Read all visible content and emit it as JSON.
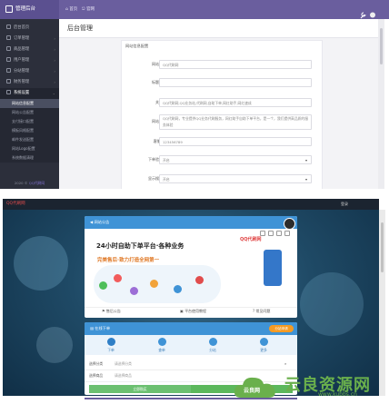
{
  "admin": {
    "brand": "管理后台",
    "top_links": [
      "首页",
      "官网"
    ],
    "page_title": "后台管理",
    "sidebar": {
      "items": [
        {
          "label": "后台首页"
        },
        {
          "label": "订单管理"
        },
        {
          "label": "商品管理"
        },
        {
          "label": "用户管理"
        },
        {
          "label": "分站管理"
        },
        {
          "label": "财务管理"
        },
        {
          "label": "系统设置",
          "active": true
        }
      ],
      "subitems": [
        {
          "label": "网站信息配置",
          "selected": true
        },
        {
          "label": "网站公告配置"
        },
        {
          "label": "支付接口配置"
        },
        {
          "label": "模板风格配置"
        },
        {
          "label": "邮件发送配置"
        },
        {
          "label": "网站Logo配置"
        },
        {
          "label": "系统数据清理"
        }
      ],
      "footer_prefix": "2020 ©",
      "footer_link": "QQ代刷网"
    },
    "form": {
      "title": "网站信息配置",
      "rows": [
        {
          "label": "网站名称",
          "value": "QQ代刷网",
          "type": "input"
        },
        {
          "label": "标题后缀",
          "value": "",
          "type": "input"
        },
        {
          "label": "关键字",
          "value": "QQ代刷网,QQ业务站,代刷网,自助下单,网红助手,网红速成",
          "type": "input"
        },
        {
          "label": "网站描述",
          "value": "QQ代刷网，专业提供QQ业务代刷服务，网红助手自助下单平台，是一个，我们提供高品质的服务体验",
          "type": "textarea"
        },
        {
          "label": "客服QQ",
          "value": "123456789",
          "type": "input"
        },
        {
          "label": "下单验证码",
          "value": "开启",
          "type": "select"
        },
        {
          "label": "显示搜索框",
          "value": "开启",
          "type": "select"
        }
      ]
    }
  },
  "site": {
    "brand": "QQ代刷网",
    "login": "登录",
    "panel1": {
      "title": "网站公告",
      "headline": "24小时自助下单平台·各种业务",
      "subline": "完美售后·致力打造全网第一",
      "logo_text": "QQ代刷网",
      "footer": [
        "售后公告",
        "平台使用教程",
        "常见问题"
      ]
    },
    "panel2": {
      "title": "在线下单",
      "badge": "分站申请",
      "tabs": [
        "下单",
        "查单",
        "分站",
        "更多"
      ],
      "rows": [
        {
          "label": "选择分类",
          "value": "请选择分类"
        },
        {
          "label": "选择商品",
          "value": "请选择商品"
        }
      ],
      "buy_label": "立即购买"
    }
  },
  "watermark": {
    "text": "云良资源网",
    "small": "云良网",
    "url": "www.kubbs.cn"
  },
  "colors": {
    "admin_topbar": "#6a5e9e",
    "sidebar": "#2c2f3b",
    "panel_head": "#3f93d6",
    "badge": "#f59a23",
    "watermark": "#6ab04c"
  }
}
